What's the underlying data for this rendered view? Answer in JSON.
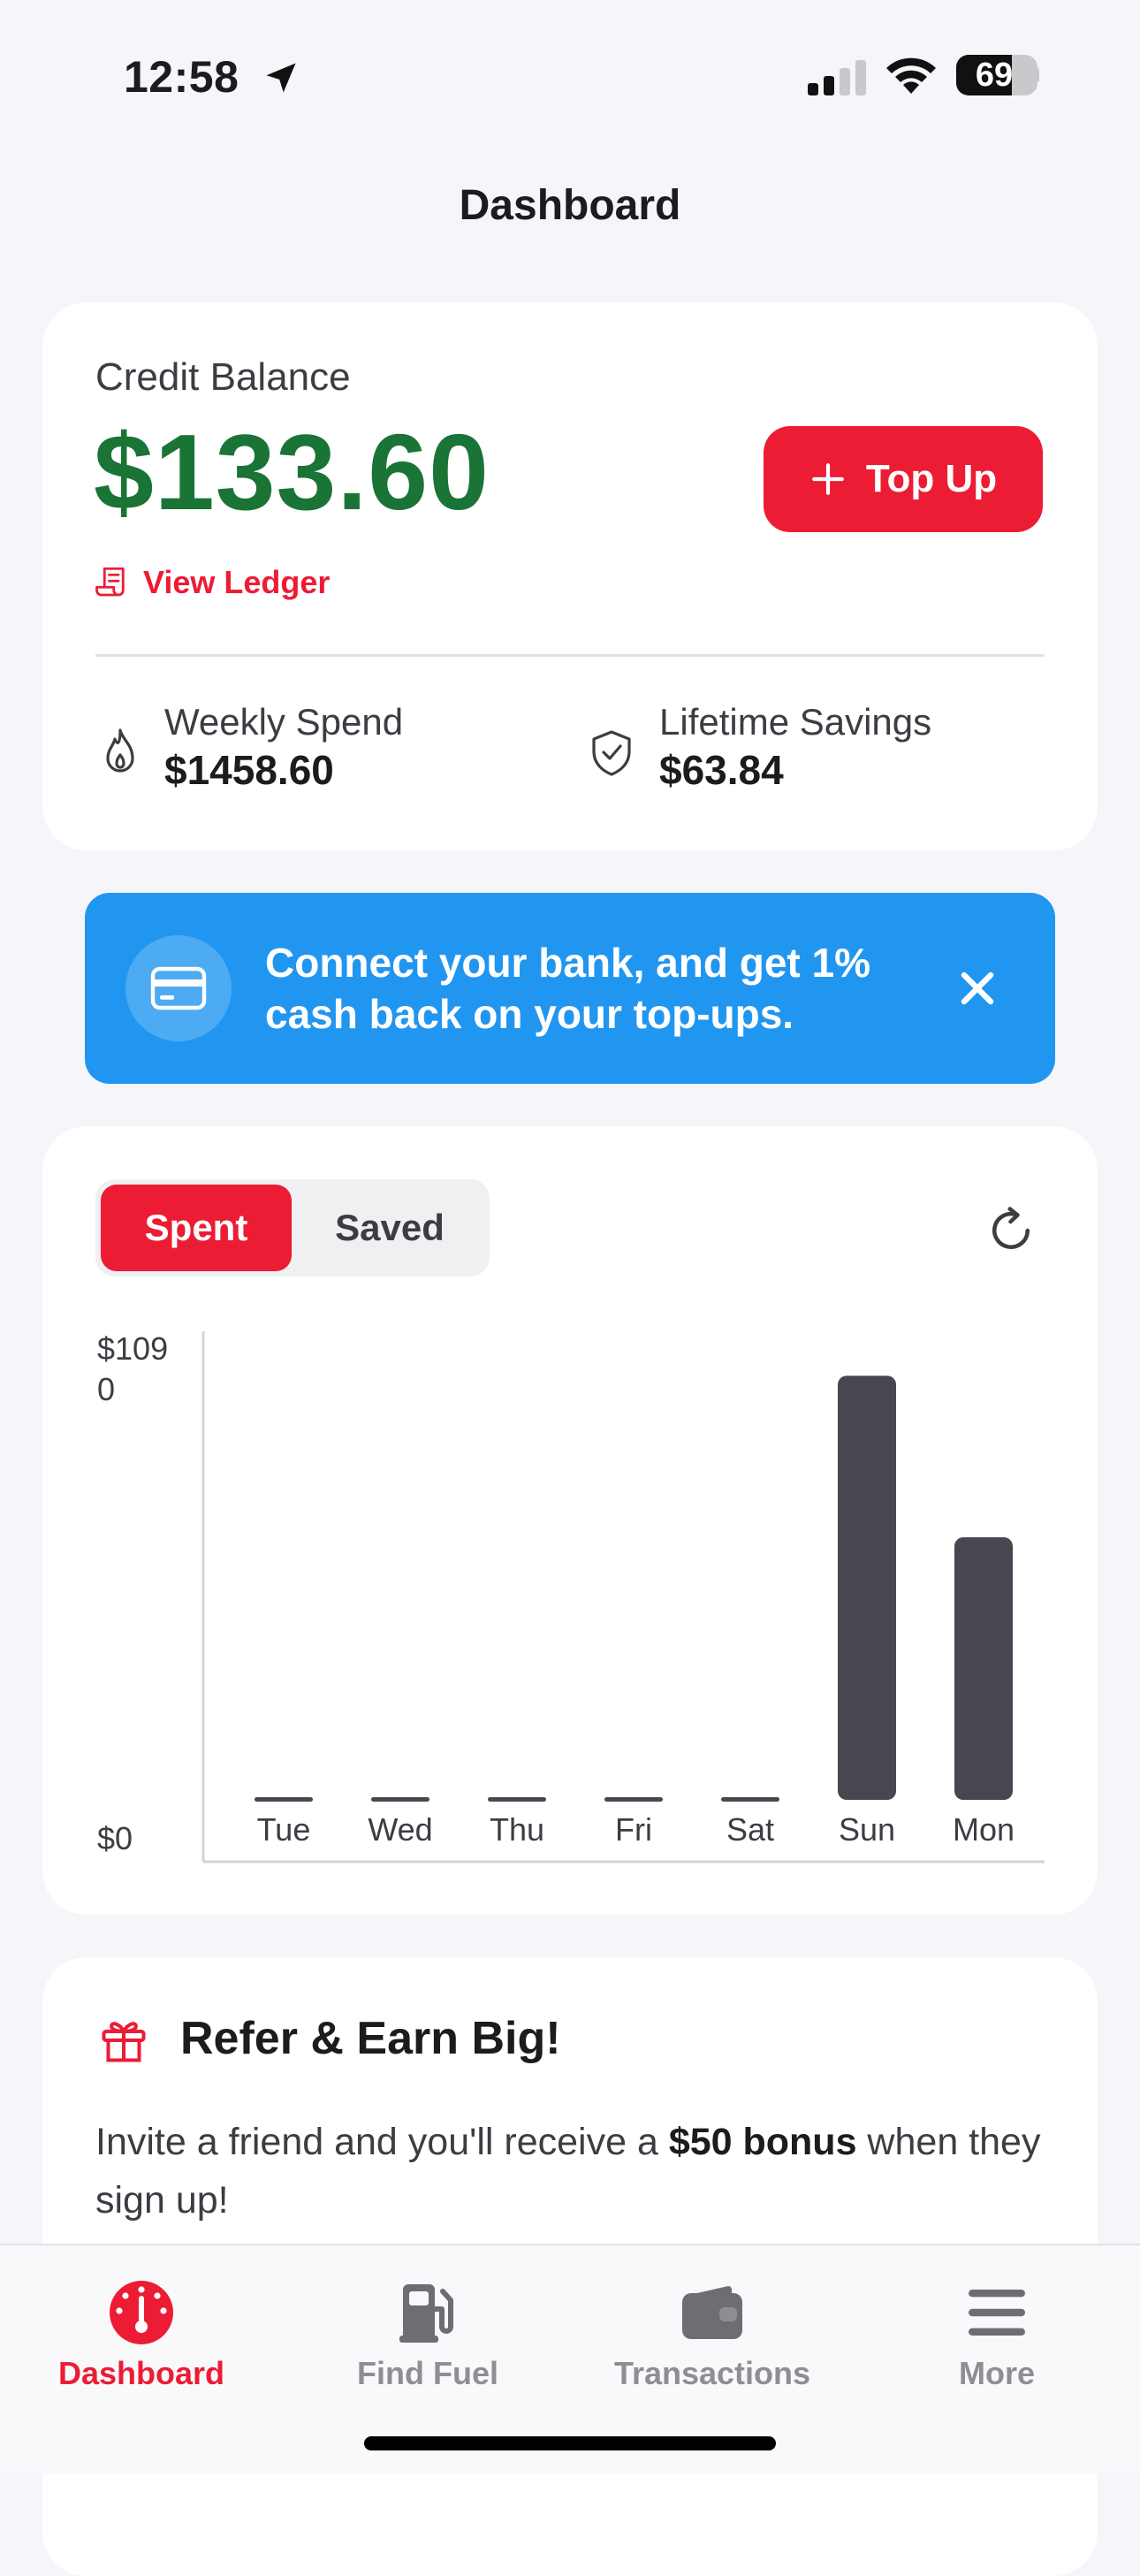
{
  "status_bar": {
    "time": "12:58",
    "battery": "69",
    "battery_level": 0.69
  },
  "header": {
    "title": "Dashboard"
  },
  "balance": {
    "label": "Credit Balance",
    "amount": "$133.60",
    "top_up_label": "Top Up",
    "ledger_label": "View Ledger",
    "weekly_spend_label": "Weekly Spend",
    "weekly_spend_value": "$1458.60",
    "lifetime_savings_label": "Lifetime Savings",
    "lifetime_savings_value": "$63.84"
  },
  "bank_banner": {
    "line1": "Connect your bank, and get 1%",
    "line2": "cash back on your top-ups."
  },
  "chart": {
    "toggle_spent": "Spent",
    "toggle_saved": "Saved"
  },
  "chart_data": {
    "type": "bar",
    "categories": [
      "Tue",
      "Wed",
      "Thu",
      "Fri",
      "Sat",
      "Sun",
      "Mon"
    ],
    "values": [
      0,
      0,
      0,
      0,
      0,
      1050,
      650
    ],
    "ylim": [
      0,
      1090
    ],
    "y_ticks": [
      {
        "value": 1090,
        "lines": [
          "$109",
          "0"
        ]
      },
      {
        "value": 0,
        "lines": [
          "$0"
        ]
      }
    ],
    "bar_color": "#48464f",
    "grid": false
  },
  "refer": {
    "title": "Refer & Earn Big!",
    "text_before": "Invite a friend and you'll receive a ",
    "text_bold": "$50 bonus",
    "text_after": " when they sign up!"
  },
  "tabs": [
    {
      "label": "Dashboard",
      "icon": "gauge-icon",
      "active": true
    },
    {
      "label": "Find Fuel",
      "icon": "fuel-pump-icon",
      "active": false
    },
    {
      "label": "Transactions",
      "icon": "wallet-icon",
      "active": false
    },
    {
      "label": "More",
      "icon": "menu-icon",
      "active": false
    }
  ],
  "colors": {
    "accent": "#ec1c35",
    "balance_green": "#1a7436",
    "banner_blue": "#2196f0",
    "tab_inactive": "#8e8e93"
  }
}
